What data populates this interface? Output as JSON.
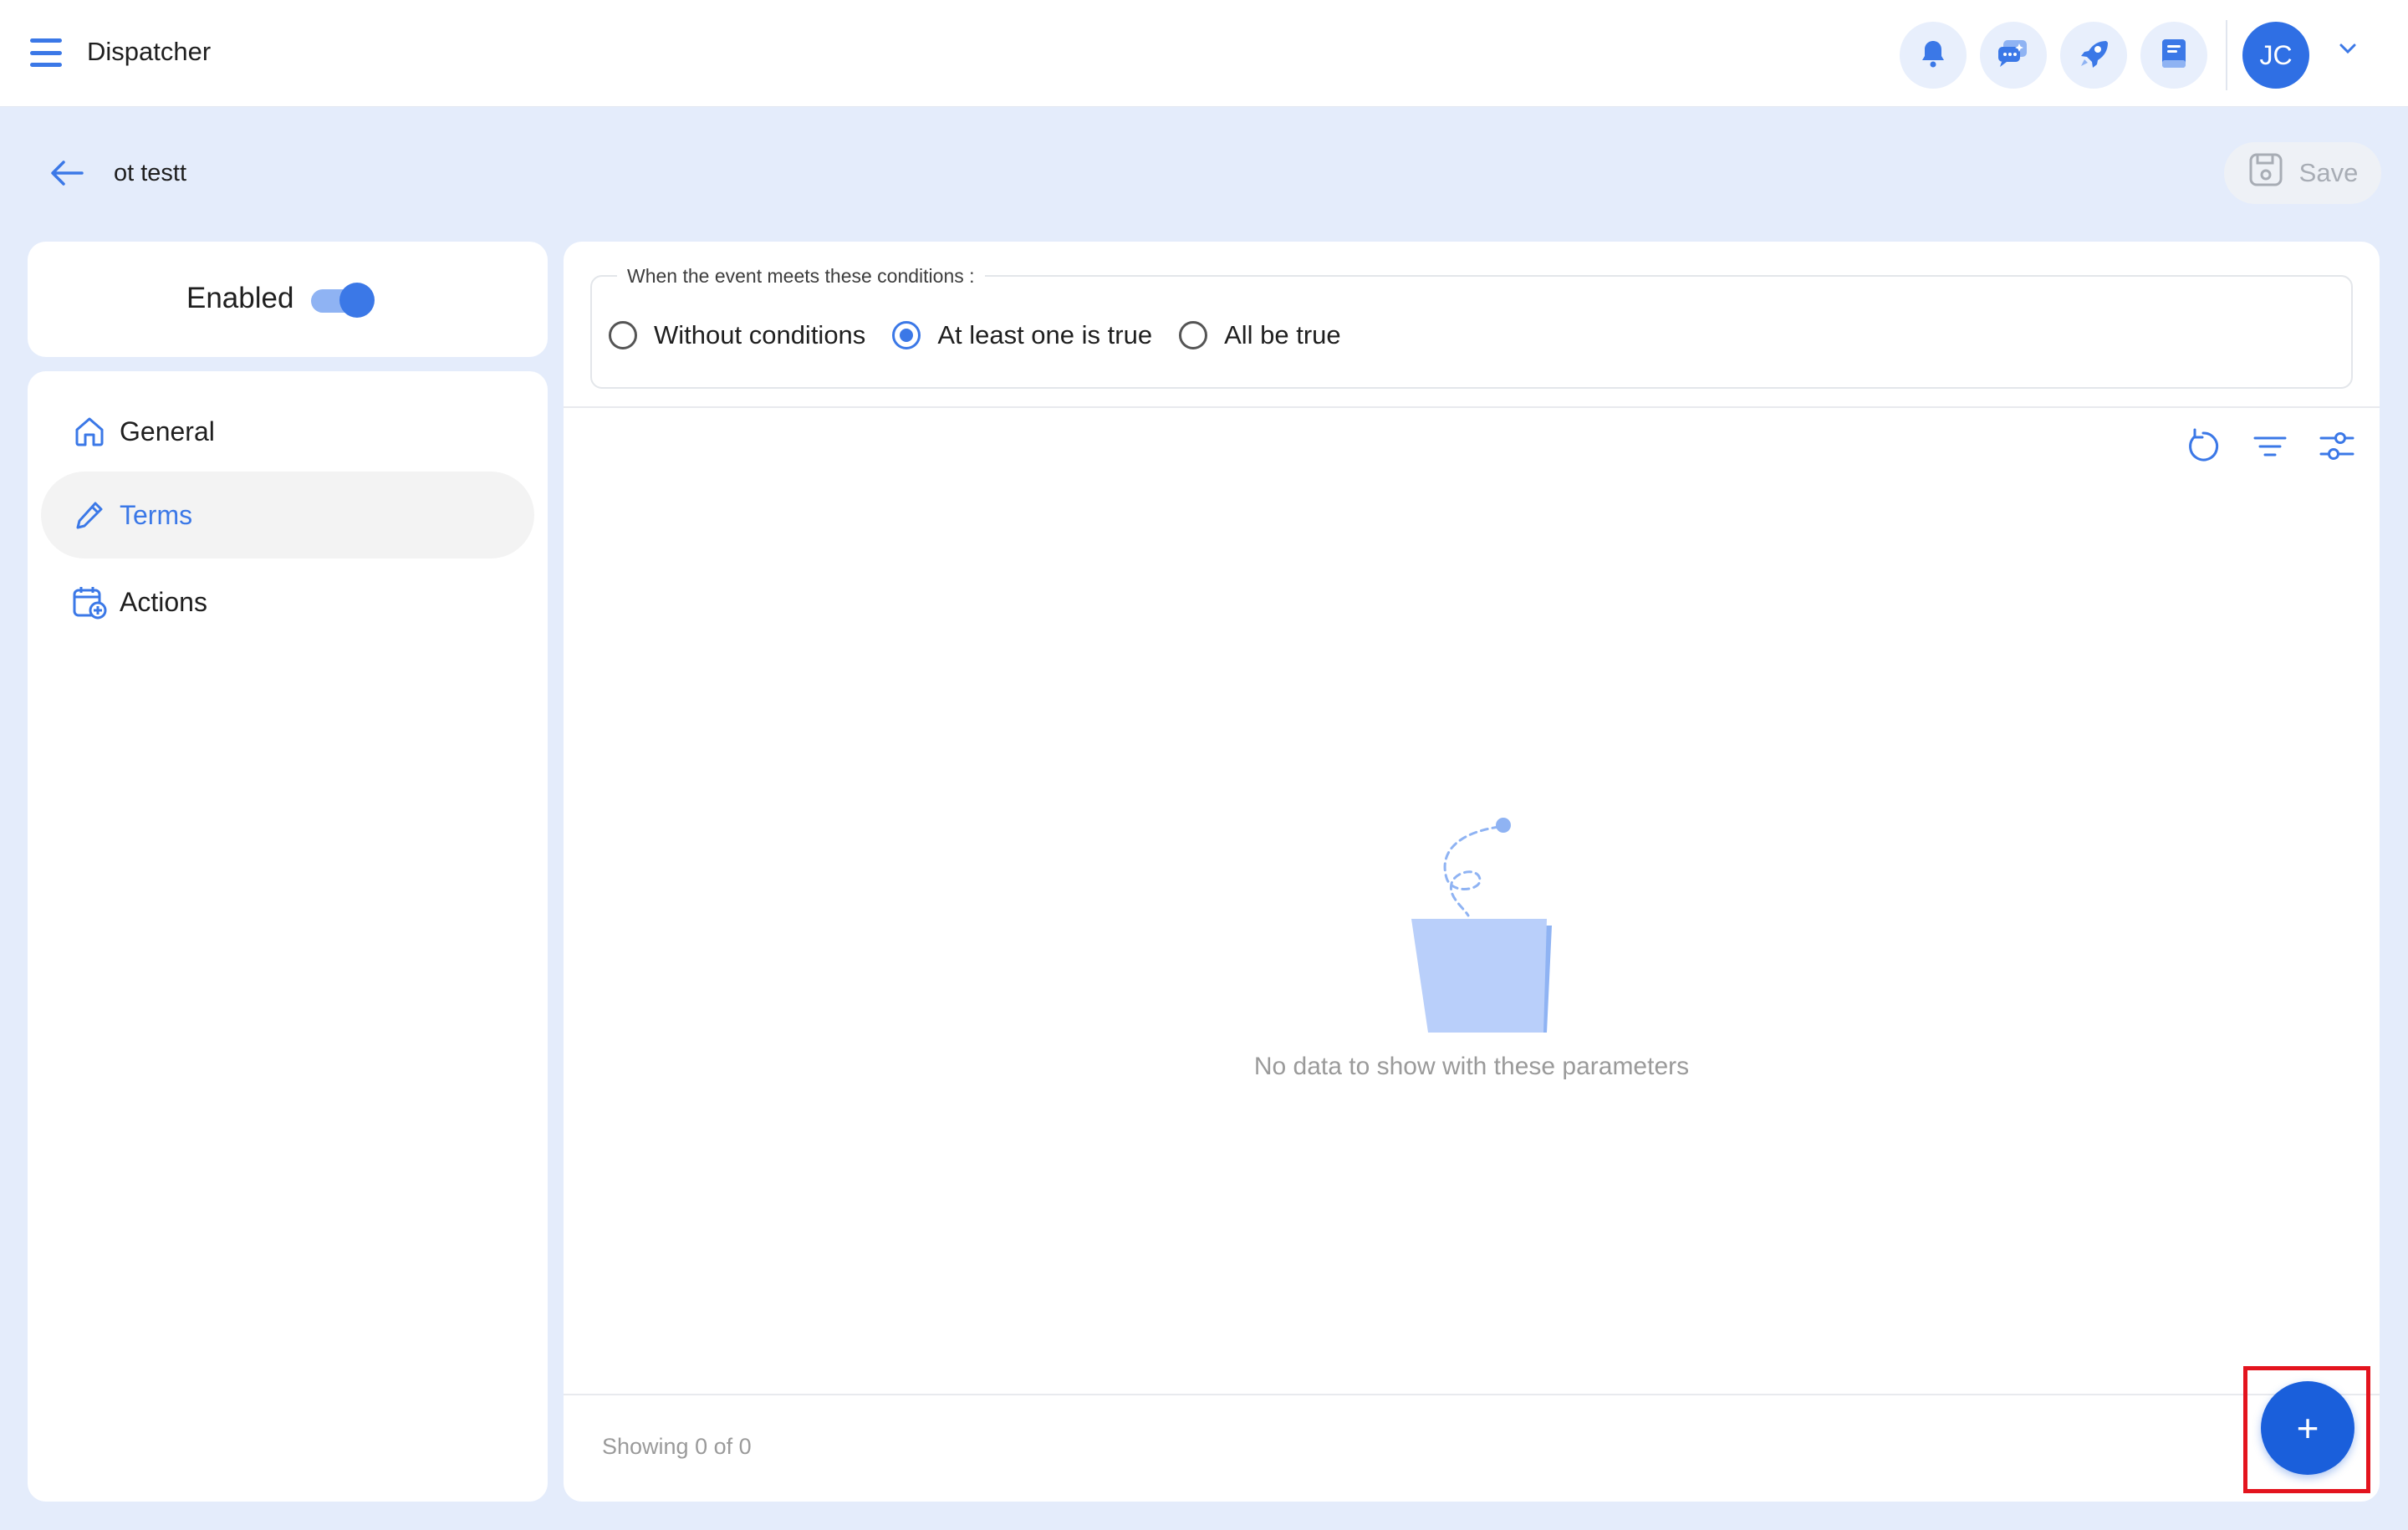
{
  "header": {
    "app_title": "Dispatcher",
    "icons": [
      "bell-icon",
      "chat-sparkle-icon",
      "rocket-icon",
      "notes-icon"
    ],
    "avatar_initials": "JC"
  },
  "subheader": {
    "page_title": "ot testt",
    "save_label": "Save"
  },
  "sidebar": {
    "enabled_label": "Enabled",
    "enabled": true,
    "items": [
      {
        "label": "General",
        "icon": "home-icon",
        "active": false
      },
      {
        "label": "Terms",
        "icon": "pencil-icon",
        "active": true
      },
      {
        "label": "Actions",
        "icon": "calendar-add-icon",
        "active": false
      }
    ]
  },
  "conditions": {
    "legend": "When the event meets these conditions :",
    "options": [
      {
        "label": "Without conditions",
        "checked": false
      },
      {
        "label": "At least one is true",
        "checked": true
      },
      {
        "label": "All be true",
        "checked": false
      }
    ]
  },
  "table": {
    "tools": [
      "refresh-icon",
      "filter-icon",
      "settings-sliders-icon"
    ],
    "empty_text": "No data to show with these parameters",
    "footer_text": "Showing 0 of 0"
  },
  "fab": {
    "label": "+"
  },
  "colors": {
    "accent": "#3b78e7",
    "fab": "#1a5fdb",
    "background": "#e4ecfb",
    "highlight": "#e3141e"
  }
}
